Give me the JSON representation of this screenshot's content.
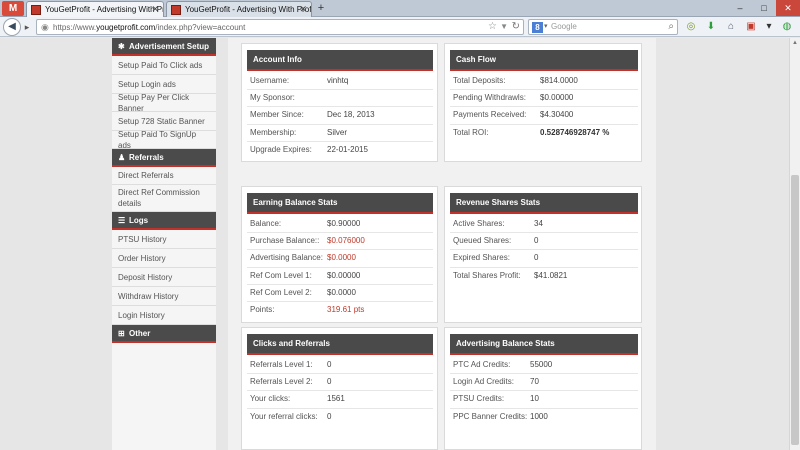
{
  "browser": {
    "gmail_label": "M",
    "tabs": [
      {
        "title": "YouGetProfit - Advertising With Profit"
      },
      {
        "title": "YouGetProfit - Advertising With Profit"
      }
    ],
    "new_tab": "+",
    "controls": {
      "minimize": "–",
      "maximize": "□",
      "close": "✕"
    },
    "url_prefix": "https://www.",
    "url_domain": "yougetprofit.com",
    "url_path": "/index.php?view=account",
    "search_placeholder": "Google",
    "search_engine_letter": "8"
  },
  "sidebar": {
    "sections": [
      {
        "icon": "gear-icon",
        "title": "Advertisement Setup",
        "items": [
          "Setup Paid To Click ads",
          "Setup Login ads",
          "Setup Pay Per Click Banner",
          "Setup 728 Static Banner",
          "Setup Paid To SignUp ads"
        ]
      },
      {
        "icon": "users-icon",
        "title": "Referrals",
        "items": [
          "Direct Referrals",
          "Direct Ref Commission details"
        ]
      },
      {
        "icon": "list-icon",
        "title": "Logs",
        "items": [
          "PTSU History",
          "Order History",
          "Deposit History",
          "Withdraw History",
          "Login History"
        ]
      },
      {
        "icon": "plus-icon",
        "title": "Other",
        "items": []
      }
    ]
  },
  "panels": {
    "account_info": {
      "title": "Account Info",
      "rows": [
        {
          "label": "Username:",
          "value": "vinhtq"
        },
        {
          "label": "My Sponsor:",
          "value": ""
        },
        {
          "label": "Member Since:",
          "value": "Dec 18, 2013"
        },
        {
          "label": "Membership:",
          "value": "Silver"
        },
        {
          "label": "Upgrade Expires:",
          "value": "22-01-2015"
        }
      ]
    },
    "cash_flow": {
      "title": "Cash Flow",
      "rows": [
        {
          "label": "Total Deposits:",
          "value": "$814.0000"
        },
        {
          "label": "Pending Withdrawls:",
          "value": "$0.00000"
        },
        {
          "label": "Payments Received:",
          "value": "$4.30400"
        },
        {
          "label": "Total ROI:",
          "value": "0.528746928747 %"
        }
      ]
    },
    "earning_balance": {
      "title": "Earning Balance Stats",
      "rows": [
        {
          "label": "Balance:",
          "value": "$0.90000"
        },
        {
          "label": "Purchase Balance::",
          "value": "$0.076000"
        },
        {
          "label": "Advertising Balance:",
          "value": "$0.0000"
        },
        {
          "label": "Ref Com Level 1:",
          "value": "$0.00000"
        },
        {
          "label": "Ref Com Level 2:",
          "value": "$0.0000"
        },
        {
          "label": "Points:",
          "value": "319.61 pts"
        }
      ]
    },
    "revenue_shares": {
      "title": "Revenue Shares Stats",
      "rows": [
        {
          "label": "Active Shares:",
          "value": "34"
        },
        {
          "label": "Queued Shares:",
          "value": "0"
        },
        {
          "label": "Expired Shares:",
          "value": "0"
        },
        {
          "label": "Total Shares Profit:",
          "value": "$41.0821"
        }
      ]
    },
    "clicks_referrals": {
      "title": "Clicks and Referrals",
      "rows": [
        {
          "label": "Referrals Level 1:",
          "value": "0"
        },
        {
          "label": "Referrals Level 2:",
          "value": "0"
        },
        {
          "label": "Your clicks:",
          "value": "1561"
        },
        {
          "label": "Your referral clicks:",
          "value": "0"
        }
      ]
    },
    "advertising_balance": {
      "title": "Advertising Balance Stats",
      "rows": [
        {
          "label": "PTC Ad Credits:",
          "value": "55000"
        },
        {
          "label": "Login Ad Credits:",
          "value": "70"
        },
        {
          "label": "PTSU Credits:",
          "value": "10"
        },
        {
          "label": "PPC Banner Credits:",
          "value": "1000"
        }
      ]
    }
  },
  "colors": {
    "accent_red": "#c2322b",
    "header_dark": "#4a4a4a",
    "value_red": "#c0392b"
  }
}
